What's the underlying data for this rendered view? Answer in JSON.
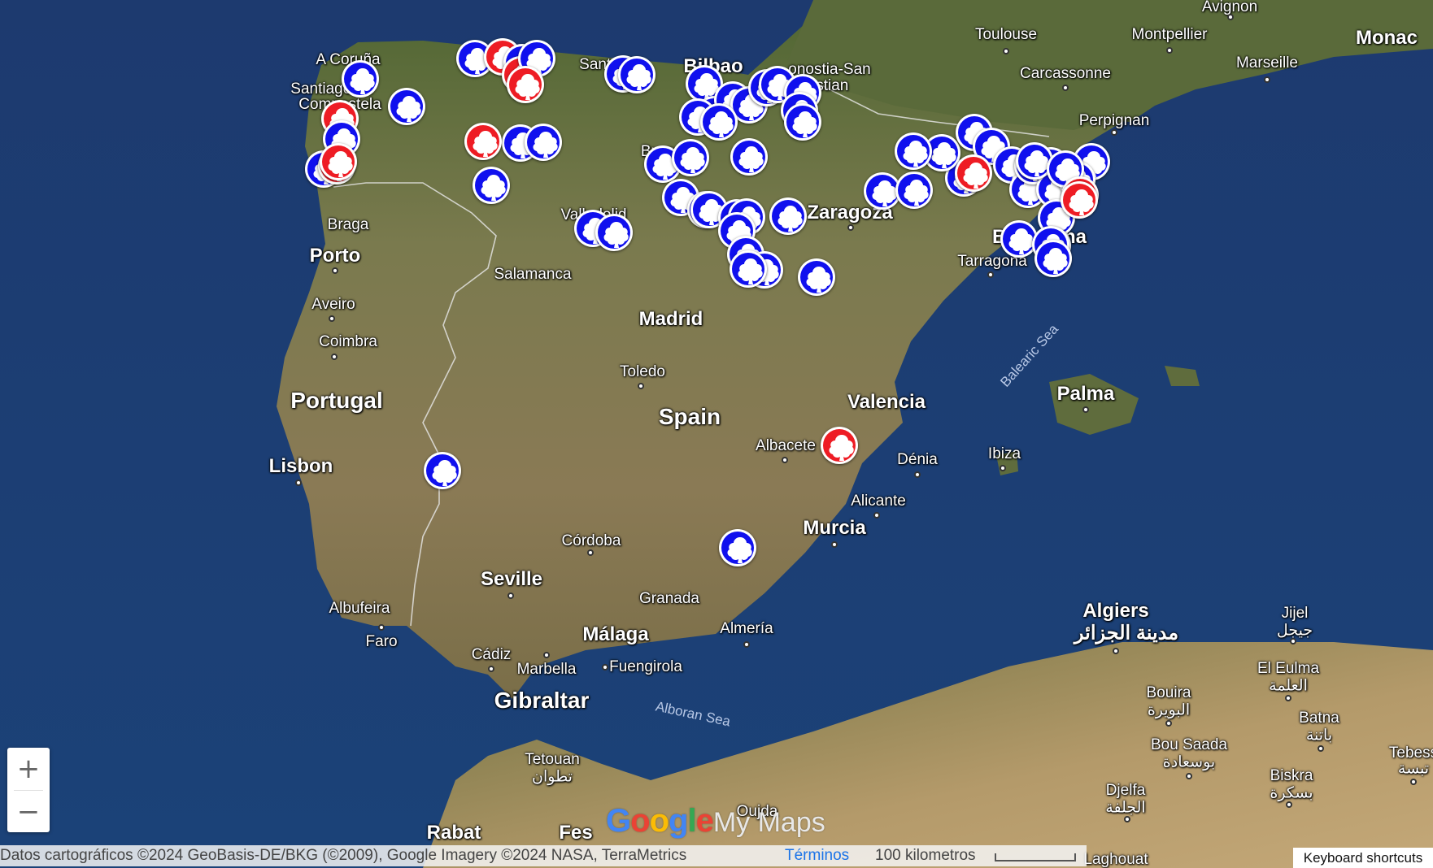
{
  "colors": {
    "sea": "#21467f",
    "land": "#6f7a4a",
    "marker_blue": "#1010ee",
    "marker_red": "#ee1c24"
  },
  "labels": [
    {
      "id": "toulouse",
      "text": "Toulouse",
      "cls": "city"
    },
    {
      "id": "montpellier",
      "text": "Montpellier",
      "cls": "city"
    },
    {
      "id": "avignon",
      "text": "Avignon",
      "cls": "city"
    },
    {
      "id": "monaco",
      "text": "Monac",
      "cls": "big"
    },
    {
      "id": "marseille",
      "text": "Marseille",
      "cls": "city"
    },
    {
      "id": "carcassonne",
      "text": "Carcassonne",
      "cls": "city"
    },
    {
      "id": "perpignan",
      "text": "Perpignan",
      "cls": "city"
    },
    {
      "id": "acoruna",
      "text": "A Coruña",
      "cls": "city"
    },
    {
      "id": "santiago",
      "text": "Santiago de",
      "cls": "city"
    },
    {
      "id": "compostela",
      "text": "Compostela",
      "cls": "city"
    },
    {
      "id": "santander",
      "text": "Santa",
      "cls": "city"
    },
    {
      "id": "bilbao",
      "text": "Bilbao",
      "cls": "big"
    },
    {
      "id": "sansebastian",
      "text": "onostia-San",
      "cls": "city"
    },
    {
      "id": "sansebastian2",
      "text": "astian",
      "cls": "city"
    },
    {
      "id": "burgos",
      "text": "Burgos",
      "cls": "city"
    },
    {
      "id": "valladolid",
      "text": "Valladolid",
      "cls": "city"
    },
    {
      "id": "zaragoza",
      "text": "Zaragoza",
      "cls": "big"
    },
    {
      "id": "braga",
      "text": "Braga",
      "cls": "city"
    },
    {
      "id": "porto",
      "text": "Porto",
      "cls": "big"
    },
    {
      "id": "salamanca",
      "text": "Salamanca",
      "cls": "city"
    },
    {
      "id": "aveiro",
      "text": "Aveiro",
      "cls": "city"
    },
    {
      "id": "coimbra",
      "text": "Coimbra",
      "cls": "city"
    },
    {
      "id": "tarragona",
      "text": "Tarragona",
      "cls": "city"
    },
    {
      "id": "barcelona",
      "text": "Barcelona",
      "cls": "big"
    },
    {
      "id": "madrid",
      "text": "Madrid",
      "cls": "big"
    },
    {
      "id": "toledo",
      "text": "Toledo",
      "cls": "city"
    },
    {
      "id": "portugal",
      "text": "Portugal",
      "cls": "country"
    },
    {
      "id": "spain",
      "text": "Spain",
      "cls": "country"
    },
    {
      "id": "valencia",
      "text": "Valencia",
      "cls": "big"
    },
    {
      "id": "palma",
      "text": "Palma",
      "cls": "big"
    },
    {
      "id": "lisbon",
      "text": "Lisbon",
      "cls": "big"
    },
    {
      "id": "albacete",
      "text": "Albacete",
      "cls": "city"
    },
    {
      "id": "denia",
      "text": "Dénia",
      "cls": "city"
    },
    {
      "id": "ibiza",
      "text": "Ibiza",
      "cls": "city"
    },
    {
      "id": "alicante",
      "text": "Alicante",
      "cls": "city"
    },
    {
      "id": "murcia",
      "text": "Murcia",
      "cls": "big"
    },
    {
      "id": "cordoba",
      "text": "Córdoba",
      "cls": "city"
    },
    {
      "id": "seville",
      "text": "Seville",
      "cls": "big"
    },
    {
      "id": "granada",
      "text": "Granada",
      "cls": "city"
    },
    {
      "id": "albufeira",
      "text": "Albufeira",
      "cls": "city"
    },
    {
      "id": "faro",
      "text": "Faro",
      "cls": "city"
    },
    {
      "id": "malaga",
      "text": "Málaga",
      "cls": "big"
    },
    {
      "id": "almeria",
      "text": "Almería",
      "cls": "city"
    },
    {
      "id": "cadiz",
      "text": "Cádiz",
      "cls": "city"
    },
    {
      "id": "marbella",
      "text": "Marbella",
      "cls": "city"
    },
    {
      "id": "fuengirola",
      "text": "Fuengirola",
      "cls": "city"
    },
    {
      "id": "gibraltar",
      "text": "Gibraltar",
      "cls": "country"
    },
    {
      "id": "alboran",
      "text": "Alboran Sea",
      "cls": "sea"
    },
    {
      "id": "balearic",
      "text": "Balearic Sea",
      "cls": "sea"
    },
    {
      "id": "algiers",
      "text": "Algiers",
      "cls": "big"
    },
    {
      "id": "algiers_ar",
      "text": "مدينة الجزائر",
      "cls": "big"
    },
    {
      "id": "jijel",
      "text": "Jijel",
      "cls": "city"
    },
    {
      "id": "jijel_ar",
      "text": "جيجل",
      "cls": "city"
    },
    {
      "id": "eleulma",
      "text": "El Eulma",
      "cls": "city"
    },
    {
      "id": "eleulma_ar",
      "text": "العلمة",
      "cls": "city"
    },
    {
      "id": "bouira",
      "text": "Bouira",
      "cls": "city"
    },
    {
      "id": "bouira_ar",
      "text": "البويرة",
      "cls": "city"
    },
    {
      "id": "batna",
      "text": "Batna",
      "cls": "city"
    },
    {
      "id": "batna_ar",
      "text": "باتنة",
      "cls": "city"
    },
    {
      "id": "bousaada",
      "text": "Bou Saada",
      "cls": "city"
    },
    {
      "id": "bousaada_ar",
      "text": "بوسعادة",
      "cls": "city"
    },
    {
      "id": "tebessa",
      "text": "Tebess",
      "cls": "city"
    },
    {
      "id": "tebessa_ar",
      "text": "تبسة",
      "cls": "city"
    },
    {
      "id": "biskra",
      "text": "Biskra",
      "cls": "city"
    },
    {
      "id": "biskra_ar",
      "text": "بسكرة",
      "cls": "city"
    },
    {
      "id": "djelfa",
      "text": "Djelfa",
      "cls": "city"
    },
    {
      "id": "djelfa_ar",
      "text": "الجلفة",
      "cls": "city"
    },
    {
      "id": "tetouan",
      "text": "Tetouan",
      "cls": "city"
    },
    {
      "id": "tetouan_ar",
      "text": "تطوان",
      "cls": "city"
    },
    {
      "id": "oujda",
      "text": "Oujda",
      "cls": "city"
    },
    {
      "id": "rabat",
      "text": "Rabat",
      "cls": "big"
    },
    {
      "id": "fes",
      "text": "Fes",
      "cls": "big"
    },
    {
      "id": "laghouat",
      "text": "Laghouat",
      "cls": "city"
    }
  ],
  "markers": [
    {
      "c": "blue"
    },
    {
      "c": "red"
    },
    {
      "c": "blue"
    },
    {
      "c": "red"
    },
    {
      "c": "blue"
    },
    {
      "c": "red"
    },
    {
      "c": "blue"
    },
    {
      "c": "red"
    },
    {
      "c": "blue"
    },
    {
      "c": "blue"
    },
    {
      "c": "red"
    },
    {
      "c": "blue"
    },
    {
      "c": "blue"
    },
    {
      "c": "blue"
    },
    {
      "c": "red"
    },
    {
      "c": "blue"
    },
    {
      "c": "blue"
    },
    {
      "c": "blue"
    },
    {
      "c": "red"
    },
    {
      "c": "blue"
    },
    {
      "c": "blue"
    },
    {
      "c": "blue"
    },
    {
      "c": "blue"
    },
    {
      "c": "blue"
    },
    {
      "c": "blue"
    },
    {
      "c": "blue"
    },
    {
      "c": "blue"
    },
    {
      "c": "blue"
    },
    {
      "c": "blue"
    },
    {
      "c": "blue"
    },
    {
      "c": "blue"
    },
    {
      "c": "blue"
    },
    {
      "c": "blue"
    },
    {
      "c": "blue"
    },
    {
      "c": "blue"
    },
    {
      "c": "blue"
    },
    {
      "c": "blue"
    },
    {
      "c": "blue"
    },
    {
      "c": "blue"
    },
    {
      "c": "blue"
    },
    {
      "c": "blue"
    },
    {
      "c": "blue"
    },
    {
      "c": "blue"
    },
    {
      "c": "blue"
    },
    {
      "c": "blue"
    },
    {
      "c": "blue"
    },
    {
      "c": "blue"
    },
    {
      "c": "blue"
    },
    {
      "c": "blue"
    },
    {
      "c": "blue"
    },
    {
      "c": "blue"
    },
    {
      "c": "blue"
    },
    {
      "c": "blue"
    },
    {
      "c": "blue"
    },
    {
      "c": "blue"
    },
    {
      "c": "red"
    },
    {
      "c": "blue"
    },
    {
      "c": "blue"
    },
    {
      "c": "blue"
    },
    {
      "c": "blue"
    },
    {
      "c": "blue"
    },
    {
      "c": "blue"
    },
    {
      "c": "blue"
    },
    {
      "c": "red"
    },
    {
      "c": "blue"
    },
    {
      "c": "blue"
    },
    {
      "c": "red"
    },
    {
      "c": "blue"
    },
    {
      "c": "blue"
    },
    {
      "c": "red"
    },
    {
      "c": "red"
    },
    {
      "c": "blue"
    },
    {
      "c": "blue"
    }
  ],
  "controls": {
    "zoom_in": "+",
    "zoom_out": "−"
  },
  "logo": {
    "google": "Google",
    "mymaps": "My Maps"
  },
  "footer": {
    "attribution": "Datos cartográficos ©2024 GeoBasis-DE/BKG (©2009), Google Imagery ©2024 NASA, TerraMetrics",
    "terms": "Términos",
    "scale": "100 kilometros",
    "keyboard": "Keyboard shortcuts"
  }
}
